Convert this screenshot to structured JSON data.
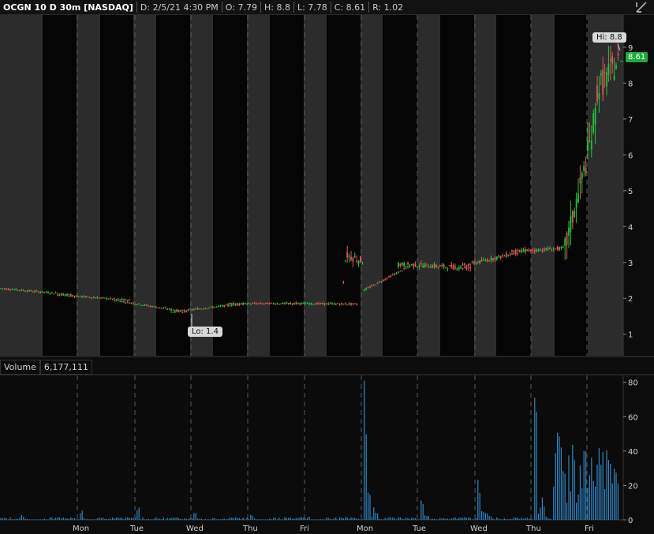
{
  "header": {
    "symbol": "OCGN 10 D 30m [NASDAQ]",
    "date": "D: 2/5/21 4:30 PM",
    "open": "O: 7.79",
    "high": "H: 8.8",
    "low": "L: 7.78",
    "close": "C: 8.61",
    "range": "R: 1.02"
  },
  "price_pane": {
    "hi_label": "Hi: 8.8",
    "lo_label": "Lo: 1.4",
    "last_price": "8.61",
    "up_color": "#22c33a",
    "down_color": "#e0555a"
  },
  "volume_pane": {
    "title": "Volume",
    "value": "6,177,111",
    "bar_color": "#2f86c8"
  },
  "chart_data": [
    {
      "type": "candlestick",
      "title": "OCGN 10 D 30m [NASDAQ]",
      "x_tick_labels": [
        "Mon",
        "Tue",
        "Wed",
        "Thu",
        "Fri",
        "Mon",
        "Tue",
        "Wed",
        "Thu",
        "Fri"
      ],
      "y_tick_labels": [
        "1",
        "2",
        "3",
        "4",
        "5",
        "6",
        "7",
        "8",
        "9"
      ],
      "ylim": [
        0.4,
        9.9
      ],
      "grid": "session shading with dashed day separators",
      "series": [
        {
          "name": "price",
          "sessions": [
            {
              "day": "Mon",
              "start": 2.28,
              "end": 2.1
            },
            {
              "day": "Tue",
              "start": 2.1,
              "end": 1.95
            },
            {
              "day": "Wed",
              "start": 1.95,
              "end": 1.62
            },
            {
              "day": "Thu",
              "start": 1.62,
              "end": 1.85
            },
            {
              "day": "Fri",
              "start": 1.85,
              "end": 1.86
            },
            {
              "day": "Mon",
              "start": 1.86,
              "end": 1.84
            },
            {
              "day": "Tue",
              "start": 1.9,
              "end": 2.95
            },
            {
              "day": "Wed",
              "start": 2.95,
              "end": 2.85
            },
            {
              "day": "Thu",
              "start": 2.85,
              "end": 3.35
            },
            {
              "day": "Fri",
              "start": 3.3,
              "end": 8.61
            }
          ],
          "high": 8.8,
          "low": 1.4,
          "last": 8.61
        }
      ]
    },
    {
      "type": "bar",
      "title": "Volume",
      "y_tick_labels": [
        "0",
        "20",
        "40",
        "60",
        "80"
      ],
      "ylim": [
        0,
        84
      ],
      "series": [
        {
          "name": "volume",
          "daily_peaks": [
            3.0,
            6.0,
            8.0,
            6.0,
            3.0,
            2.0,
            81.0,
            13.0,
            26.0,
            73.0
          ]
        }
      ]
    }
  ]
}
